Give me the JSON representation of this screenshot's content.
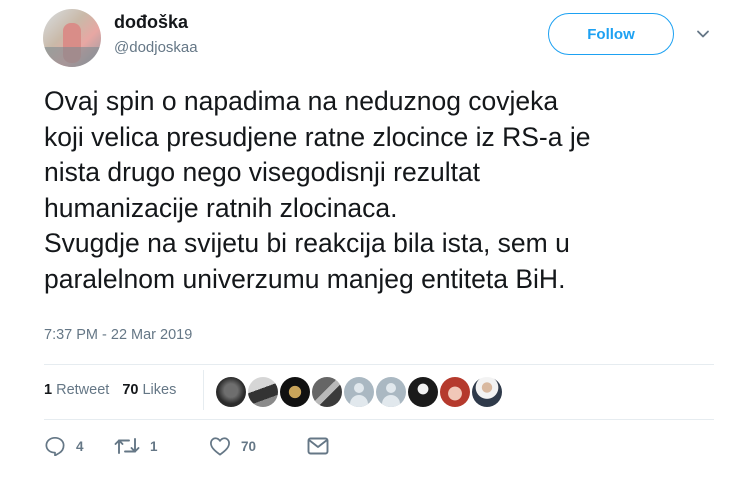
{
  "user": {
    "display_name": "dođoška",
    "handle": "@dodjoskaa"
  },
  "follow_label": "Follow",
  "tweet": {
    "lines": [
      "Ovaj spin o napadima na neduznog covjeka",
      "koji velica presudjene ratne zlocince iz RS-a je",
      "nista drugo nego visegodisnji rezultat",
      "humanizacije ratnih zlocinaca.",
      "Svugdje na svijetu bi reakcija bila ista, sem u",
      "paralelnom univerzumu manjeg entiteta BiH."
    ],
    "timestamp": "7:37 PM - 22 Mar 2019"
  },
  "stats": {
    "retweet_count": "1",
    "retweet_label": "Retweet",
    "like_count": "70",
    "like_label": "Likes"
  },
  "actions": {
    "reply_count": "4",
    "retweet_count": "1",
    "like_count": "70"
  },
  "colors": {
    "accent": "#1da1f2",
    "secondary_text": "#657786",
    "divider": "#e6ecf0"
  }
}
